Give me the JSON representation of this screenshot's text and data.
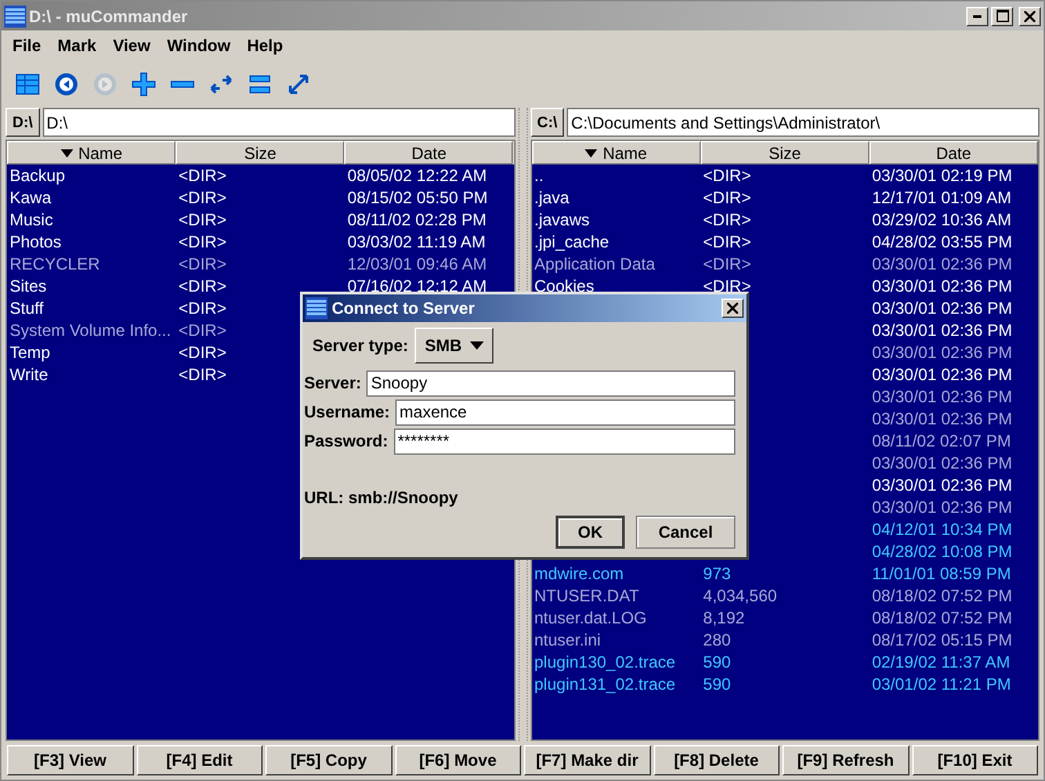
{
  "window": {
    "title": "D:\\ - muCommander"
  },
  "menu": [
    "File",
    "Mark",
    "View",
    "Window",
    "Help"
  ],
  "toolbar": [
    {
      "kind": "table",
      "disabled": false
    },
    {
      "kind": "back",
      "disabled": false
    },
    {
      "kind": "forward",
      "disabled": true
    },
    {
      "kind": "plus",
      "disabled": false
    },
    {
      "kind": "minus",
      "disabled": false
    },
    {
      "kind": "swap",
      "disabled": false
    },
    {
      "kind": "equal",
      "disabled": false
    },
    {
      "kind": "expand",
      "disabled": false
    }
  ],
  "panels": [
    {
      "drive": "D:\\",
      "path": "D:\\",
      "columns": [
        {
          "label": "Name",
          "sorted": true
        },
        {
          "label": "Size",
          "sorted": false
        },
        {
          "label": "Date",
          "sorted": false
        }
      ],
      "rows": [
        {
          "name": "Backup",
          "size": "<DIR>",
          "date": "08/05/02 12:22 AM",
          "kind": "plain"
        },
        {
          "name": "Kawa",
          "size": "<DIR>",
          "date": "08/15/02 05:50 PM",
          "kind": "plain"
        },
        {
          "name": "Music",
          "size": "<DIR>",
          "date": "08/11/02 02:28 PM",
          "kind": "plain"
        },
        {
          "name": "Photos",
          "size": "<DIR>",
          "date": "03/03/02 11:19 AM",
          "kind": "plain"
        },
        {
          "name": "RECYCLER",
          "size": "<DIR>",
          "date": "12/03/01 09:46 AM",
          "kind": "hidden"
        },
        {
          "name": "Sites",
          "size": "<DIR>",
          "date": "07/16/02 12:12 AM",
          "kind": "plain"
        },
        {
          "name": "Stuff",
          "size": "<DIR>",
          "kind": "plain"
        },
        {
          "name": "System Volume Info...",
          "size": "<DIR>",
          "kind": "hidden"
        },
        {
          "name": "Temp",
          "size": "<DIR>",
          "kind": "plain"
        },
        {
          "name": "Write",
          "size": "<DIR>",
          "kind": "plain"
        }
      ]
    },
    {
      "drive": "C:\\",
      "path": "C:\\Documents and Settings\\Administrator\\",
      "columns": [
        {
          "label": "Name",
          "sorted": true
        },
        {
          "label": "Size",
          "sorted": false
        },
        {
          "label": "Date",
          "sorted": false
        }
      ],
      "rows": [
        {
          "name": "..",
          "size": "<DIR>",
          "date": "03/30/01 02:19 PM",
          "kind": "plain"
        },
        {
          "name": ".java",
          "size": "<DIR>",
          "date": "12/17/01 01:09 AM",
          "kind": "plain"
        },
        {
          "name": ".javaws",
          "size": "<DIR>",
          "date": "03/29/02 10:36 AM",
          "kind": "plain"
        },
        {
          "name": ".jpi_cache",
          "size": "<DIR>",
          "date": "04/28/02 03:55 PM",
          "kind": "plain"
        },
        {
          "name": "Application Data",
          "size": "<DIR>",
          "date": "03/30/01 02:36 PM",
          "kind": "hidden"
        },
        {
          "name": "Cookies",
          "size": "<DIR>",
          "date": "03/30/01 02:36 PM",
          "kind": "plain"
        },
        {
          "date": "03/30/01 02:36 PM",
          "kind": "plain"
        },
        {
          "date": "03/30/01 02:36 PM",
          "kind": "plain"
        },
        {
          "date": "03/30/01 02:36 PM",
          "kind": "hidden"
        },
        {
          "date": "03/30/01 02:36 PM",
          "kind": "plain"
        },
        {
          "date": "03/30/01 02:36 PM",
          "kind": "hidden"
        },
        {
          "date": "03/30/01 02:36 PM",
          "kind": "hidden"
        },
        {
          "date": "08/11/02 02:07 PM",
          "kind": "hidden"
        },
        {
          "date": "03/30/01 02:36 PM",
          "kind": "hidden"
        },
        {
          "date": "03/30/01 02:36 PM",
          "kind": "plain"
        },
        {
          "date": "03/30/01 02:36 PM",
          "kind": "hidden"
        },
        {
          "date": "04/12/01 10:34 PM",
          "kind": "highlight"
        },
        {
          "date": "04/28/02 10:08 PM",
          "kind": "highlight"
        },
        {
          "name": "mdwire.com",
          "size": "973",
          "date": "11/01/01 08:59 PM",
          "kind": "highlight"
        },
        {
          "name": "NTUSER.DAT",
          "size": "4,034,560",
          "date": "08/18/02 07:52 PM",
          "kind": "hidden"
        },
        {
          "name": "ntuser.dat.LOG",
          "size": "8,192",
          "date": "08/18/02 07:52 PM",
          "kind": "hidden"
        },
        {
          "name": "ntuser.ini",
          "size": "280",
          "date": "08/17/02 05:15 PM",
          "kind": "hidden"
        },
        {
          "name": "plugin130_02.trace",
          "size": "590",
          "date": "02/19/02 11:37 AM",
          "kind": "highlight"
        },
        {
          "name": "plugin131_02.trace",
          "size": "590",
          "date": "03/01/02 11:21 PM",
          "kind": "highlight"
        }
      ]
    }
  ],
  "dialog": {
    "title": "Connect to Server",
    "server_type_label": "Server type:",
    "server_type": "SMB",
    "fields": [
      {
        "label": "Server:",
        "value": "Snoopy"
      },
      {
        "label": "Username:",
        "value": "maxence"
      },
      {
        "label": "Password:",
        "value": "********"
      }
    ],
    "url": "URL: smb://Snoopy",
    "buttons": [
      {
        "label": "OK",
        "default": true
      },
      {
        "label": "Cancel",
        "default": false
      }
    ]
  },
  "function_keys": [
    "[F3] View",
    "[F4] Edit",
    "[F5] Copy",
    "[F6] Move",
    "[F7] Make dir",
    "[F8] Delete",
    "[F9] Refresh",
    "[F10] Exit"
  ]
}
